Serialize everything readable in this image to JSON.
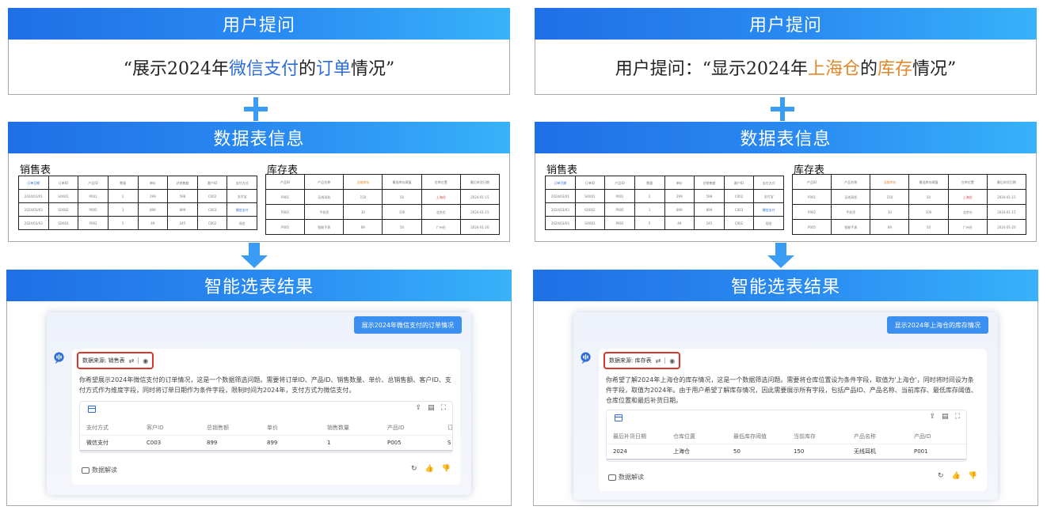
{
  "left": {
    "question_banner": "用户提问",
    "question_parts": [
      {
        "text": "“展示2024年",
        "style": ""
      },
      {
        "text": "微信支付",
        "style": "blue"
      },
      {
        "text": "的",
        "style": ""
      },
      {
        "text": "订单",
        "style": "blue"
      },
      {
        "text": "情况”",
        "style": ""
      }
    ],
    "table_banner": "数据表信息",
    "sales_title": "销售表",
    "inventory_title": "库存表",
    "result_banner": "智能选表结果",
    "user_message": "展示2024年微信支付的订单情况",
    "source_label": "数据来源: 销售表",
    "answer": "你希望展示2024年微信支付的订单情况，这是一个数据筛选问题。需要将订单ID、产品ID、销售数量、单价、总销售额、客户ID、支付方式作为维度字段，同时将订单日期作为条件字段，限制时间为2024年，支付方式为微信支付。",
    "result_columns": [
      "支付方式",
      "客户ID",
      "总销售额",
      "单价",
      "销售数量",
      "产品ID",
      "订"
    ],
    "result_row": [
      "微信支付",
      "C003",
      "899",
      "899",
      "1",
      "P005",
      "S"
    ],
    "decode_label": "数据解读"
  },
  "right": {
    "question_banner": "用户提问",
    "question_parts": [
      {
        "text": "用户提问：“显示2024年",
        "style": ""
      },
      {
        "text": "上海仓",
        "style": "orange"
      },
      {
        "text": "的",
        "style": ""
      },
      {
        "text": "库存",
        "style": "orange"
      },
      {
        "text": "情况”",
        "style": ""
      }
    ],
    "table_banner": "数据表信息",
    "sales_title": "销售表",
    "inventory_title": "库存表",
    "result_banner": "智能选表结果",
    "user_message": "显示2024年上海仓的库存情况",
    "source_label": "数据来源: 库存表",
    "answer": "你希望了解2024年上海仓的库存情况，这是一个数据筛选问题。需要将仓库位置设为条件字段，取值为'上海仓'，同时将时间设为条件字段，取值为2024年。由于用户希望了解库存情况，因此需要展示所有字段，包括产品ID、产品名称、当前库存、最低库存阈值、仓库位置和最后补货日期。",
    "result_columns": [
      "最后补货日期",
      "仓库位置",
      "最低库存阈值",
      "当前库存",
      "产品名称",
      "产品ID"
    ],
    "result_row": [
      "2024",
      "上海仓",
      "50",
      "150",
      "无线耳机",
      "P001"
    ],
    "decode_label": "数据解读"
  },
  "sales_table": {
    "header": [
      "订单日期",
      "订单ID",
      "产品ID",
      "数量",
      "单价",
      "总销售额",
      "客户ID",
      "支付方式"
    ],
    "rows": [
      [
        "2024/03/01",
        "SO001",
        "P001",
        "2",
        "299",
        "598",
        "C002",
        "支付宝"
      ],
      [
        "2024/03/03",
        "SO002",
        "P005",
        "1",
        "899",
        "899",
        "C003",
        "微信支付"
      ],
      [
        "2024/03/03",
        "SO003",
        "P002",
        "5",
        "49",
        "245",
        "C002",
        "现金"
      ]
    ]
  },
  "inventory_table": {
    "header": [
      "产品ID",
      "产品名称",
      "当前库存",
      "最低库存阈值",
      "仓库位置",
      "最后补货日期"
    ],
    "rows": [
      [
        "P001",
        "无线耳机",
        "150",
        "50",
        "上海仓",
        "2024-01-15"
      ],
      [
        "P002",
        "手机壳",
        "30",
        "100",
        "北京仓",
        "2024-01-15"
      ],
      [
        "P005",
        "智能手表",
        "89",
        "50",
        "广州仓",
        "2024-01-20"
      ]
    ]
  },
  "colors": {
    "banner_start": "#1f6fe6",
    "banner_end": "#38b2fa",
    "highlight_blue": "#2c6ed6",
    "highlight_orange": "#e0872a",
    "source_border": "#d9352b",
    "user_bubble": "#3a8ff0"
  },
  "icons": [
    "plus-icon",
    "down-arrow-icon",
    "bot-icon",
    "switch-icon",
    "eye-icon",
    "table-icon",
    "export-icon",
    "download-icon",
    "fullscreen-icon",
    "book-icon",
    "refresh-icon",
    "thumbs-up-icon",
    "thumbs-down-icon"
  ]
}
